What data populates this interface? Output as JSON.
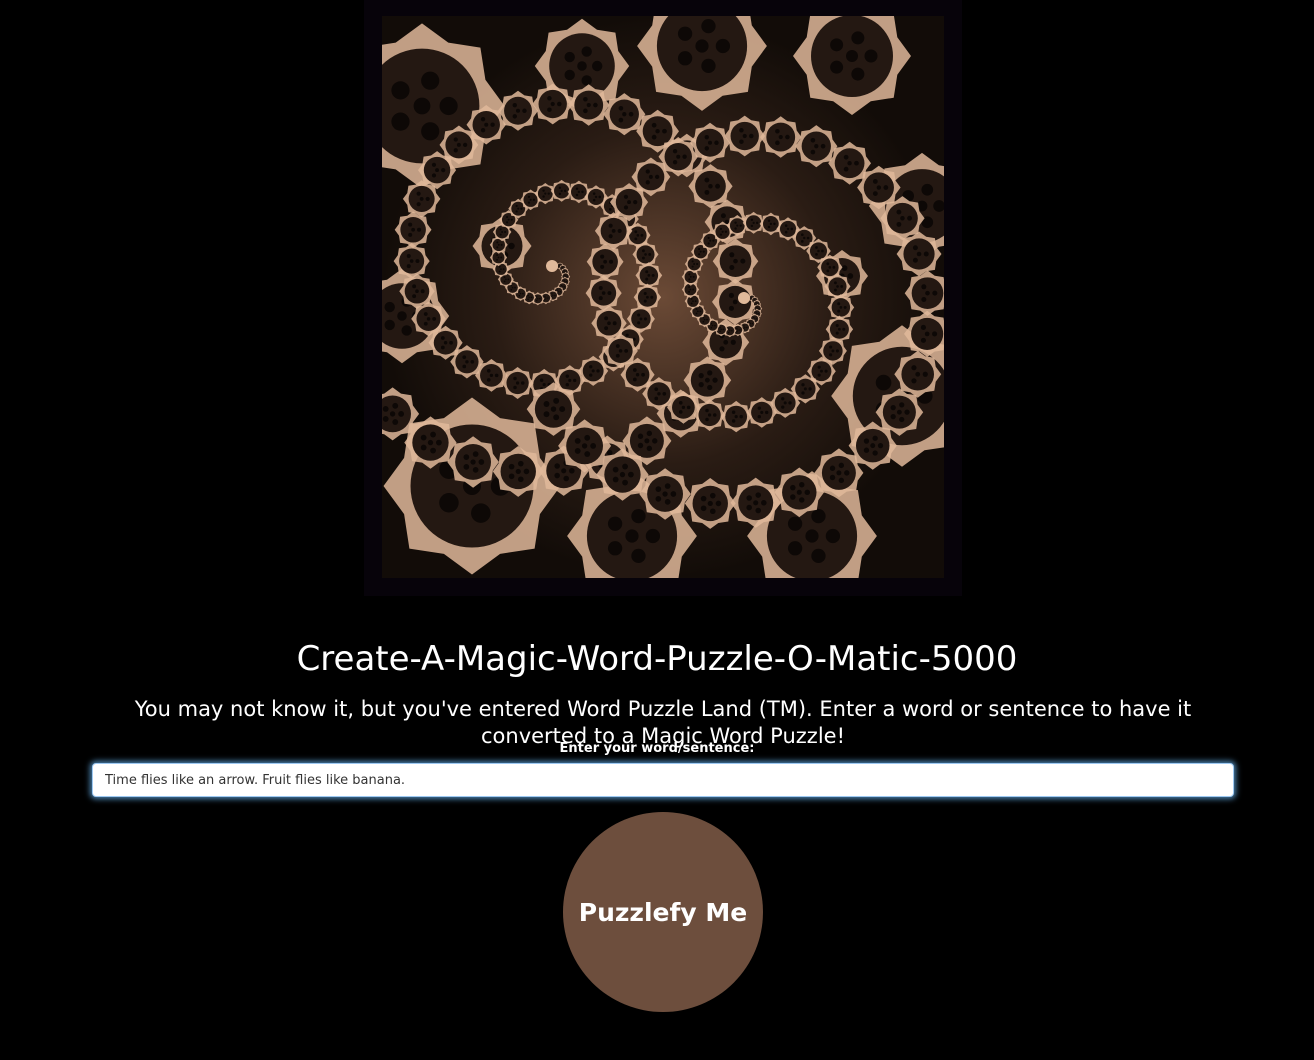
{
  "header": {
    "image_name": "fractal-gears-spiral-image"
  },
  "main": {
    "title": "Create-A-Magic-Word-Puzzle-O-Matic-5000",
    "subtitle": "You may not know it, but you've entered Word Puzzle Land (TM). Enter a word or sentence to have it converted to a Magic Word Puzzle!",
    "input_label": "Enter your word/sentence:",
    "input_value": "Time flies like an arrow. Fruit flies like banana.",
    "submit_label": "Puzzlefy Me"
  },
  "colors": {
    "background": "#000000",
    "button": "#6d4e3d",
    "art_light": "#e0b99a",
    "art_dark": "#241812",
    "input_focus": "#66afe9"
  }
}
